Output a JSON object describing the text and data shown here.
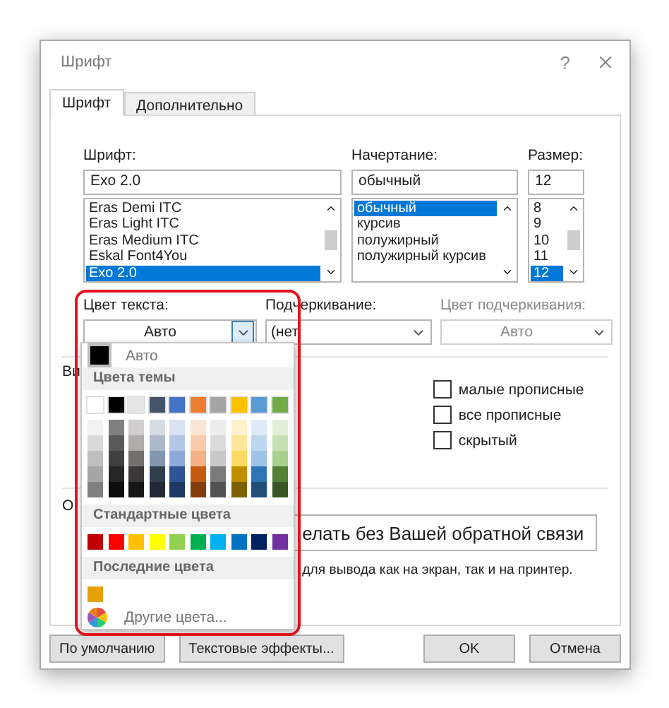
{
  "window": {
    "title": "Шрифт",
    "help": "?"
  },
  "tabs": [
    {
      "label": "Шрифт",
      "selected": true
    },
    {
      "label": "Дополнительно",
      "selected": false
    }
  ],
  "font": {
    "label": "Шрифт:",
    "value": "Exo 2.0",
    "items": [
      {
        "label": "Eras Demi ITC",
        "selected": false
      },
      {
        "label": "Eras Light ITC",
        "selected": false
      },
      {
        "label": "Eras Medium ITC",
        "selected": false
      },
      {
        "label": "Eskal Font4You",
        "selected": false
      },
      {
        "label": "Exo 2.0",
        "selected": true
      }
    ]
  },
  "style": {
    "label": "Начертание:",
    "value": "обычный",
    "items": [
      {
        "label": "обычный",
        "selected": true
      },
      {
        "label": "курсив",
        "selected": false
      },
      {
        "label": "полужирный",
        "selected": false
      },
      {
        "label": "полужирный курсив",
        "selected": false
      }
    ]
  },
  "size": {
    "label": "Размер:",
    "value": "12",
    "items": [
      {
        "label": "8",
        "selected": false
      },
      {
        "label": "9",
        "selected": false
      },
      {
        "label": "10",
        "selected": false
      },
      {
        "label": "11",
        "selected": false
      },
      {
        "label": "12",
        "selected": true
      }
    ]
  },
  "font_color": {
    "label": "Цвет текста:",
    "value": "Авто",
    "expanded": true
  },
  "underline": {
    "label": "Подчеркивание:",
    "value": "(нет",
    "disabled": false
  },
  "underline_color": {
    "label": "Цвет подчеркивания:",
    "value": "Авто",
    "disabled": true
  },
  "effects_label": "Ви",
  "effects": [
    {
      "label": "малые прописные",
      "checked": false
    },
    {
      "label": "все прописные",
      "checked": false
    },
    {
      "label": "скрытый",
      "checked": false
    }
  ],
  "preview_label": "О",
  "preview_text": "елать без Вашей обратной связи",
  "preview_note": "для вывода как на экран, так и на принтер.",
  "palette": {
    "auto": {
      "label": "Авто",
      "color": "#000000"
    },
    "theme_title": "Цвета темы",
    "theme": [
      {
        "color": "#ffffff",
        "shades": [
          {
            "color": "#f2f2f2"
          },
          {
            "color": "#d9d9d9"
          },
          {
            "color": "#bfbfbf"
          },
          {
            "color": "#a6a6a6"
          },
          {
            "color": "#808080"
          }
        ]
      },
      {
        "color": "#000000",
        "shades": [
          {
            "color": "#808080"
          },
          {
            "color": "#595959"
          },
          {
            "color": "#404040"
          },
          {
            "color": "#262626"
          },
          {
            "color": "#0d0d0d"
          }
        ]
      },
      {
        "color": "#e7e6e6",
        "shades": [
          {
            "color": "#d0cece"
          },
          {
            "color": "#aeabab"
          },
          {
            "color": "#757070"
          },
          {
            "color": "#3a3838"
          },
          {
            "color": "#171616"
          }
        ]
      },
      {
        "color": "#44546a",
        "shades": [
          {
            "color": "#d6dce4"
          },
          {
            "color": "#adb9ca"
          },
          {
            "color": "#8496b0"
          },
          {
            "color": "#333f4f"
          },
          {
            "color": "#222a35"
          }
        ]
      },
      {
        "color": "#4472c4",
        "shades": [
          {
            "color": "#d9e2f3"
          },
          {
            "color": "#b4c6e7"
          },
          {
            "color": "#8eaadb"
          },
          {
            "color": "#2f5496"
          },
          {
            "color": "#1f3864"
          }
        ]
      },
      {
        "color": "#ed7d31",
        "shades": [
          {
            "color": "#fbe5d5"
          },
          {
            "color": "#f7cbac"
          },
          {
            "color": "#f4b183"
          },
          {
            "color": "#c55a11"
          },
          {
            "color": "#833c0b"
          }
        ]
      },
      {
        "color": "#a5a5a5",
        "shades": [
          {
            "color": "#ededed"
          },
          {
            "color": "#dbdbdb"
          },
          {
            "color": "#c9c9c9"
          },
          {
            "color": "#7b7b7b"
          },
          {
            "color": "#525252"
          }
        ]
      },
      {
        "color": "#ffc000",
        "shades": [
          {
            "color": "#fff2cc"
          },
          {
            "color": "#ffe699"
          },
          {
            "color": "#ffd966"
          },
          {
            "color": "#bf8f00"
          },
          {
            "color": "#7f6000"
          }
        ]
      },
      {
        "color": "#5b9bd5",
        "shades": [
          {
            "color": "#deebf6"
          },
          {
            "color": "#bdd7ee"
          },
          {
            "color": "#9dc3e6"
          },
          {
            "color": "#2e75b5"
          },
          {
            "color": "#1f4e79"
          }
        ]
      },
      {
        "color": "#70ad47",
        "shades": [
          {
            "color": "#e2efd9"
          },
          {
            "color": "#c5e0b3"
          },
          {
            "color": "#a8d08d"
          },
          {
            "color": "#538135"
          },
          {
            "color": "#375623"
          }
        ]
      }
    ],
    "standard_title": "Стандартные цвета",
    "standard": [
      {
        "color": "#c00000"
      },
      {
        "color": "#ff0000"
      },
      {
        "color": "#ffc000"
      },
      {
        "color": "#ffff00"
      },
      {
        "color": "#92d050"
      },
      {
        "color": "#00b050"
      },
      {
        "color": "#00b0f0"
      },
      {
        "color": "#0070c0"
      },
      {
        "color": "#002060"
      },
      {
        "color": "#7030a0"
      }
    ],
    "recent_title": "Последние цвета",
    "recent": [
      {
        "color": "#e6a10a"
      }
    ],
    "more": "Другие цвета..."
  },
  "buttons": [
    {
      "label": "По умолчанию",
      "kind": "left"
    },
    {
      "label": "Текстовые эффекты...",
      "kind": "left"
    },
    {
      "label": "OK",
      "kind": "right"
    },
    {
      "label": "Отмена",
      "kind": "right"
    }
  ]
}
